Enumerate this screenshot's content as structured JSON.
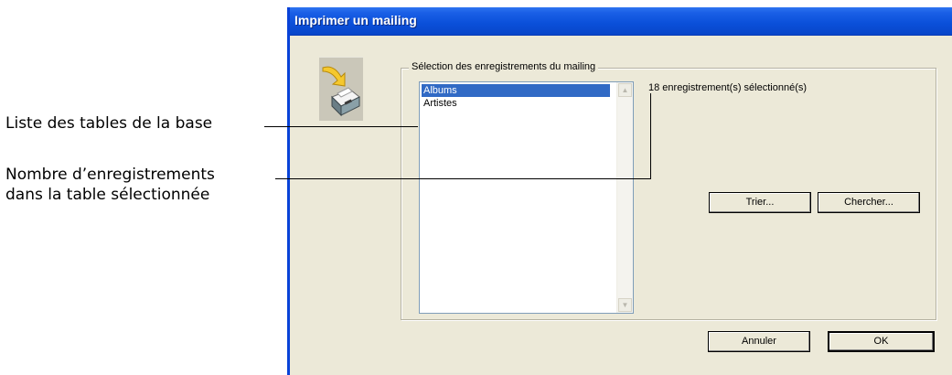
{
  "callouts": {
    "tables_list": "Liste des tables de la base",
    "records_count_line1": "Nombre d’enregistrements",
    "records_count_line2": "dans la table sélectionnée"
  },
  "window": {
    "title": "Imprimer un mailing",
    "icon": "printer-arrow-icon"
  },
  "group": {
    "legend": "Sélection des enregistrements du mailing",
    "tables": [
      {
        "label": "Albums",
        "selected": true
      },
      {
        "label": "Artistes",
        "selected": false
      }
    ],
    "record_count_text": "18 enregistrement(s) sélectionné(s)",
    "sort_button": "Trier...",
    "search_button": "Chercher..."
  },
  "footer": {
    "cancel_button": "Annuler",
    "ok_button": "OK"
  },
  "colors": {
    "titlebar": "#0a4fd9",
    "dialog_bg": "#ece9d8",
    "selection": "#316ac5"
  }
}
